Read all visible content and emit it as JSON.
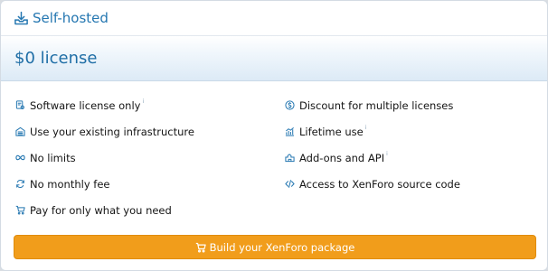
{
  "header": {
    "title": "Self-hosted",
    "icon": "download-tray-icon"
  },
  "price": {
    "label": "$0 license"
  },
  "features": {
    "left": [
      {
        "label": "Software license only",
        "icon": "license-icon",
        "note": "i"
      },
      {
        "label": "Use your existing infrastructure",
        "icon": "server-icon",
        "note": ""
      },
      {
        "label": "No limits",
        "icon": "infinity-icon",
        "note": ""
      },
      {
        "label": "No monthly fee",
        "icon": "refresh-icon",
        "note": ""
      },
      {
        "label": "Pay for only what you need",
        "icon": "cart-icon",
        "note": ""
      }
    ],
    "right": [
      {
        "label": "Discount for multiple licenses",
        "icon": "dollar-circle-icon",
        "note": ""
      },
      {
        "label": "Lifetime use",
        "icon": "chart-icon",
        "note": "i"
      },
      {
        "label": "Add-ons and API",
        "icon": "addons-icon",
        "note": "i"
      },
      {
        "label": "Access to XenForo source code",
        "icon": "code-icon",
        "note": ""
      }
    ]
  },
  "cta": {
    "label": "Build your XenForo package",
    "icon": "cart-icon"
  },
  "colors": {
    "accent": "#2577b1",
    "button": "#f19d1b",
    "icon": "#2577b1"
  }
}
